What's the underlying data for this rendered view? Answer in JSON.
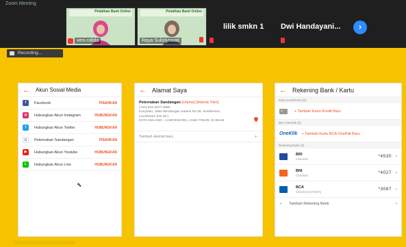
{
  "meeting": {
    "title_text": "Zoom Meeting",
    "participants": [
      {
        "name": "veni rafida",
        "banner": "Pelatihan Bank Online"
      },
      {
        "name": "Raya Sulistyowati",
        "banner": "Pelatihan Bank Online"
      },
      {
        "name": "lilik smkn 1"
      },
      {
        "name": "Dwi Handayani..."
      }
    ],
    "next_icon": "chevron-right-icon",
    "recording_label": "Recording..."
  },
  "panel1": {
    "title": "Akun Sosial Media",
    "rows": [
      {
        "label": "Facebook",
        "action": "PISAHKAN",
        "color": "#3b5998",
        "icon": "f"
      },
      {
        "label": "Hubungkan Akun Instagram",
        "action": "HUBUNGKAN",
        "color": "#d6306b",
        "icon": "◎"
      },
      {
        "label": "Hubungkan Akun Twitter",
        "action": "HUBUNGKAN",
        "color": "#1da1f2",
        "icon": "t"
      },
      {
        "label": "Peternakan Sandangan",
        "action": "PISAHKAN",
        "color": "#ffffff",
        "icon": "G"
      },
      {
        "label": "Hubungkan Akun Youtube",
        "action": "HUBUNGKAN",
        "color": "#e62117",
        "icon": "▶"
      },
      {
        "label": "Hubungkan Akun Line",
        "action": "HUBUNGKAN",
        "color": "#00c300",
        "icon": "L"
      }
    ]
  },
  "panel2": {
    "title": "Alamat Saya",
    "address": {
      "name": "Peternakan Sandangan",
      "tags": "[Utama] [Alamat Toko]",
      "phone": "(+62) 822-3227-4559",
      "street": "Kunyalan, Jalan Bendungan Sutami No.39, Sumbersari,",
      "district": "Lowokwaru (No 38.)",
      "city": "KOTA MALANG - LOWOKWARU, JAWA TIMUR, ID 65145"
    },
    "add_label": "Tambah alamat baru"
  },
  "panel3": {
    "title": "Rekening Bank / Kartu",
    "credit_section": "Kartu Kredit/Visa (0)",
    "credit_add": "+ Tambah Kartu Kredit Baru",
    "oneklik_section": "BCA OneKlik (0)",
    "oneklik_logo": "OneKlik",
    "oneklik_add": "+ Tambah Kartu BCA OneKlik Baru",
    "bank_section": "Rekening Bank (3)",
    "banks": [
      {
        "name": "BRI",
        "status": "Checked",
        "num": "*4530",
        "color": "#1f4e9a"
      },
      {
        "name": "BNI",
        "status": "Checked",
        "num": "*4027",
        "color": "#f26522"
      },
      {
        "name": "BCA",
        "status": "Checked (UTAMA)",
        "num": "*3087",
        "color": "#0060af"
      }
    ],
    "add_bank": "Tambah Rekening Bank"
  }
}
